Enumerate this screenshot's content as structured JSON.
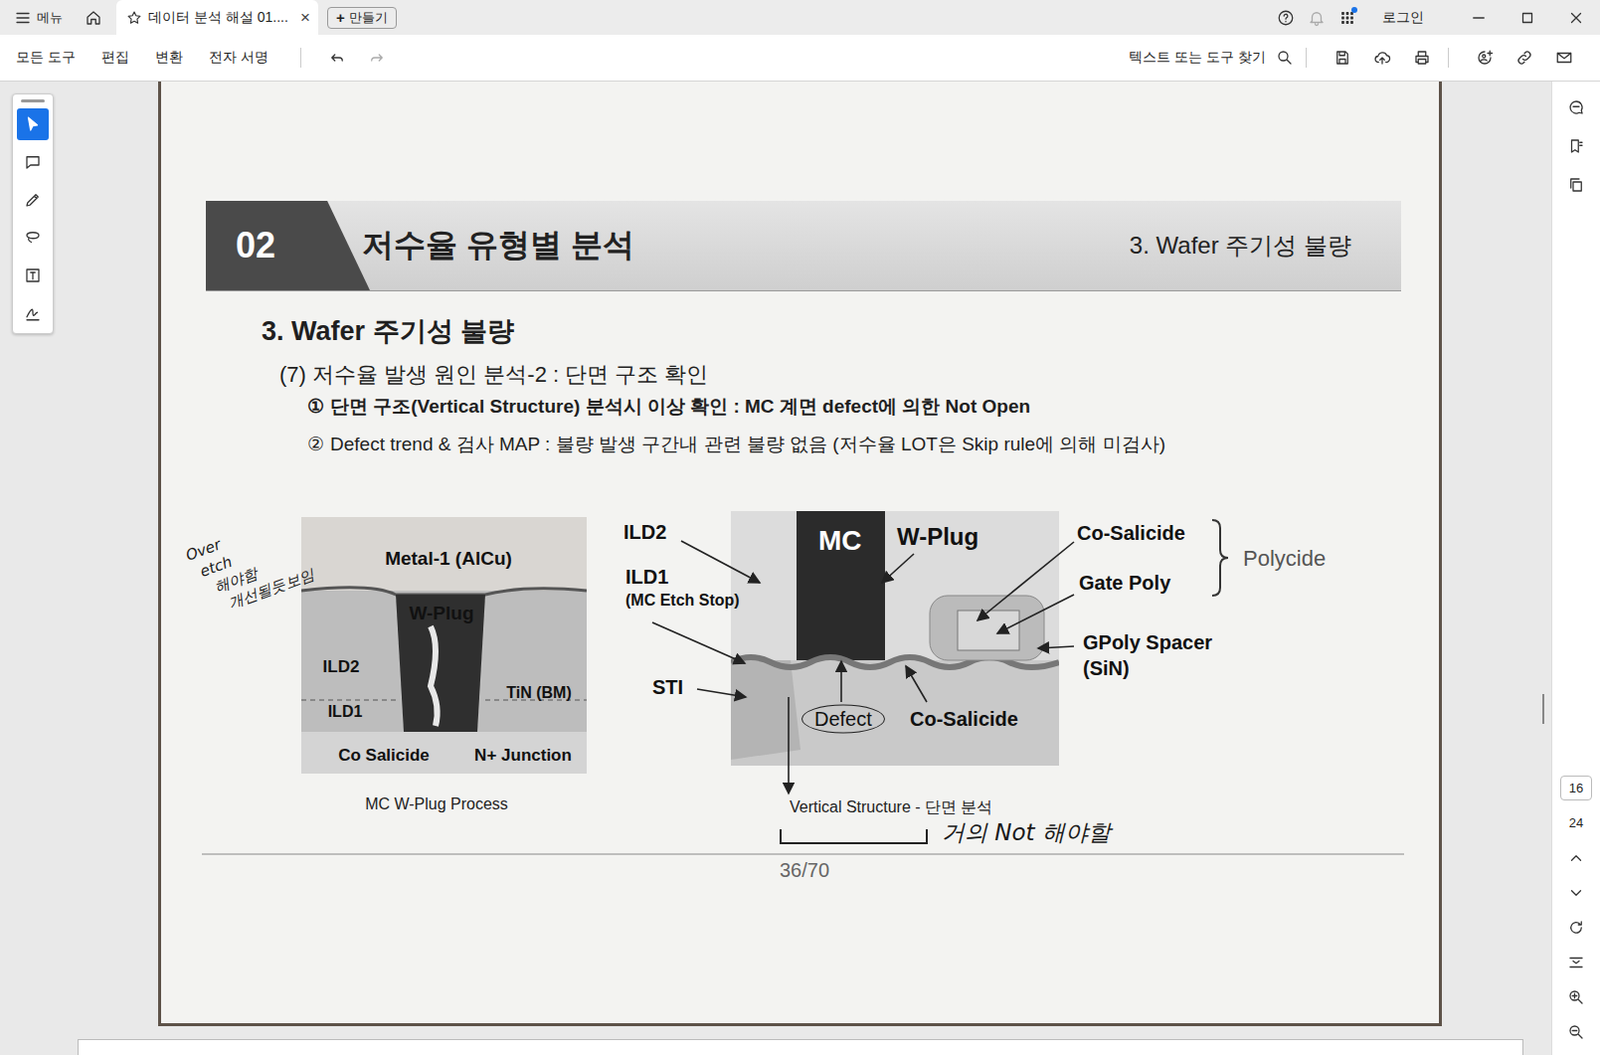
{
  "window": {
    "menu": "메뉴",
    "tabs": [
      {
        "label": "데이터 분석 해설 01....",
        "selected": true,
        "close": "×"
      }
    ],
    "new_tab": {
      "icon": "+",
      "label": "만들기"
    },
    "login": "로그인"
  },
  "toolbar": {
    "items": [
      "모든 도구",
      "편집",
      "변환",
      "전자 서명"
    ],
    "search": {
      "placeholder": "텍스트 또는 도구 찾기"
    }
  },
  "tools": [
    {
      "selected": true
    },
    {
      "selected": false
    },
    {
      "selected": false
    },
    {
      "selected": false
    },
    {
      "selected": false
    },
    {
      "selected": false
    }
  ],
  "page_nav": {
    "current": "16",
    "total": "24"
  },
  "document": {
    "section_number": "02",
    "section_title": "저수율 유형별 분석",
    "header_right": "3. Wafer 주기성 불량",
    "heading": "3. Wafer 주기성 불량",
    "subheading": "(7) 저수율 발생 원인 분석-2 : 단면 구조 확인",
    "bullets": [
      {
        "marker": "①",
        "text": "단면 구조(Vertical Structure) 분석시 이상 확인 : MC 계면 defect에 의한 Not Open",
        "emphasis": true
      },
      {
        "marker": "②",
        "text": "Defect trend & 검사 MAP : 불량 발생 구간내 관련 불량 없음 (저수율 LOT은 Skip rule에 의해 미검사)",
        "emphasis": false
      }
    ],
    "figure_left": {
      "labels": [
        "Metal-1 (AlCu)",
        "W-Plug",
        "ILD2",
        "TiN (BM)",
        "ILD1",
        "Co Salicide",
        "N+ Junction"
      ],
      "caption": "MC W-Plug Process"
    },
    "figure_right": {
      "labels": [
        {
          "text": "ILD2",
          "kind": "plain"
        },
        {
          "text": "ILD1",
          "kind": "plain"
        },
        {
          "text": "(MC Etch Stop)",
          "kind": "small"
        },
        {
          "text": "STI",
          "kind": "plain"
        },
        {
          "text": "MC",
          "kind": "inverse"
        },
        {
          "text": "W-Plug",
          "kind": "large"
        },
        {
          "text": "Co-Salicide",
          "kind": "plain"
        },
        {
          "text": "Gate Poly",
          "kind": "plain"
        },
        {
          "text": "Polycide",
          "kind": "group"
        },
        {
          "text": "GPoly Spacer",
          "kind": "plain"
        },
        {
          "text": "(SiN)",
          "kind": "plain"
        },
        {
          "text": "Defect",
          "kind": "circled"
        },
        {
          "text": "Co-Salicide",
          "kind": "plain"
        }
      ],
      "caption": "Vertical Structure - 단면 분석"
    },
    "handwritten_notes": [
      {
        "lines": [
          "Over",
          "etch",
          "해야함",
          "개선될듯보임"
        ]
      },
      {
        "lines": [
          "거의 Not 해야할"
        ]
      }
    ],
    "page_number": "36/70"
  }
}
